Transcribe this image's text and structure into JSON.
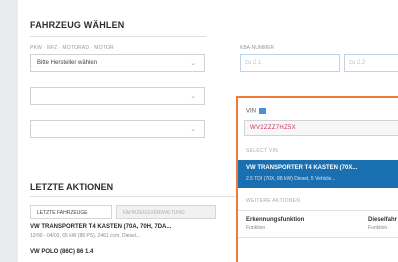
{
  "vehicle_select": {
    "title": "FAHRZEUG WÄHLEN",
    "hint": "PKW · NFZ · MOTORAD · MOTOR",
    "manufacturer_placeholder": "Bitte Hersteller wählen",
    "registration_label": "KBA-NUMMER",
    "reg_field_1": "zu 2.1",
    "reg_field_2": "zu 2.2"
  },
  "search_panel": {
    "vin_label": "VIN",
    "vin_value": "WV2ZZZ7HZ5X",
    "section_select_heading": "SELECT VIN",
    "result_title": "VW TRANSPORTER T4 KASTEN (70X...",
    "result_sub": "2.5 TDI (70X, 88 kW) Diesel, 5 Vehicle...",
    "section_actions_heading": "WEITERE AKTIONEN",
    "action_1_title": "Erkennungsfunktion",
    "action_1_sub": "Funktion",
    "action_2_title": "Dieselfahr",
    "action_2_sub": "Funktion"
  },
  "recent": {
    "title": "LETZTE AKTIONEN",
    "tab_active": "LETZTE FAHRZEUGE",
    "tab_inactive": "FAHRZEUGVERWALTUNG",
    "items": [
      {
        "title": "VW TRANSPORTER T4 KASTEN (70A, 70H, 7DA...",
        "sub": "12/90 - 04/03, 65 kW (88 PS), 2461 ccm, Diesel..."
      },
      {
        "title": "VW POLO (86C) 86 1.4",
        "sub": ""
      }
    ]
  }
}
